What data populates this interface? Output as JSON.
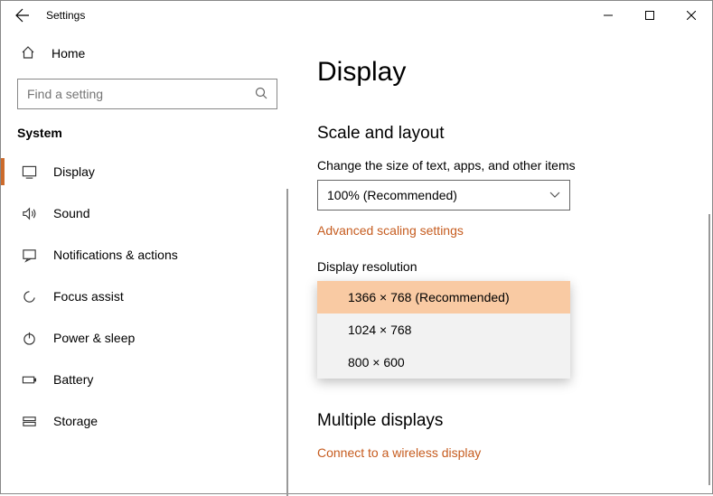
{
  "titlebar": {
    "title": "Settings"
  },
  "sidebar": {
    "home_label": "Home",
    "search_placeholder": "Find a setting",
    "section_label": "System",
    "items": [
      {
        "label": "Display"
      },
      {
        "label": "Sound"
      },
      {
        "label": "Notifications & actions"
      },
      {
        "label": "Focus assist"
      },
      {
        "label": "Power & sleep"
      },
      {
        "label": "Battery"
      },
      {
        "label": "Storage"
      }
    ]
  },
  "main": {
    "page_title": "Display",
    "scale_group": "Scale and layout",
    "scale_label": "Change the size of text, apps, and other items",
    "scale_value": "100% (Recommended)",
    "advanced_link": "Advanced scaling settings",
    "resolution_label": "Display resolution",
    "resolution_options": [
      "1366 × 768 (Recommended)",
      "1024 × 768",
      "800 × 600"
    ],
    "multiple_group": "Multiple displays",
    "wireless_link": "Connect to a wireless display"
  }
}
